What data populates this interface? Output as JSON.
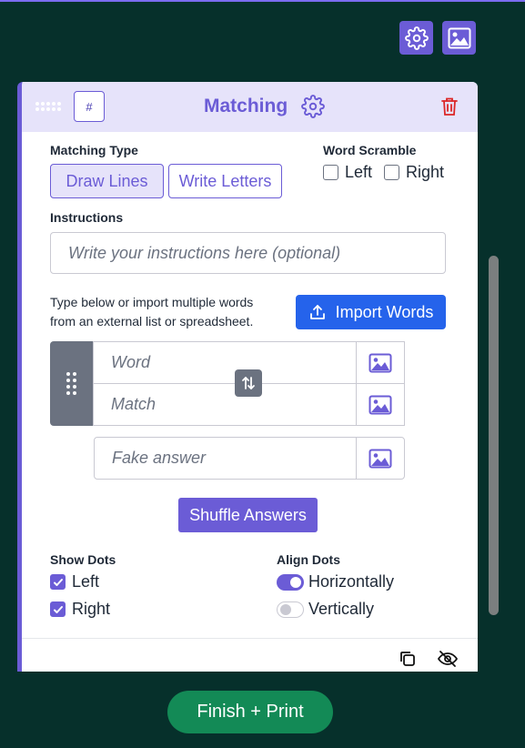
{
  "toolbar": {
    "settings_icon": "gear-icon",
    "image_icon": "image-icon"
  },
  "card": {
    "title": "Matching",
    "hash_label": "#",
    "matching_type": {
      "label": "Matching Type",
      "options": [
        "Draw Lines",
        "Write Letters"
      ],
      "selected": "Draw Lines"
    },
    "word_scramble": {
      "label": "Word Scramble",
      "left": {
        "label": "Left",
        "checked": false
      },
      "right": {
        "label": "Right",
        "checked": false
      }
    },
    "instructions": {
      "label": "Instructions",
      "placeholder": "Write your instructions here (optional)"
    },
    "help_text": "Type below or import multiple words from an external list or spreadsheet.",
    "import_button": "Import Words",
    "pair": {
      "word_placeholder": "Word",
      "match_placeholder": "Match"
    },
    "fake_answer_placeholder": "Fake answer",
    "shuffle_button": "Shuffle Answers",
    "show_dots": {
      "label": "Show Dots",
      "left": {
        "label": "Left",
        "checked": true
      },
      "right": {
        "label": "Right",
        "checked": true
      }
    },
    "align_dots": {
      "label": "Align Dots",
      "horizontally": {
        "label": "Horizontally",
        "on": true
      },
      "vertically": {
        "label": "Vertically",
        "on": false
      }
    }
  },
  "finish_button": "Finish + Print",
  "colors": {
    "background": "#06302b",
    "accent": "#6b5cd6",
    "import": "#2563eb",
    "finish": "#138a56",
    "delete": "#dc2626"
  }
}
